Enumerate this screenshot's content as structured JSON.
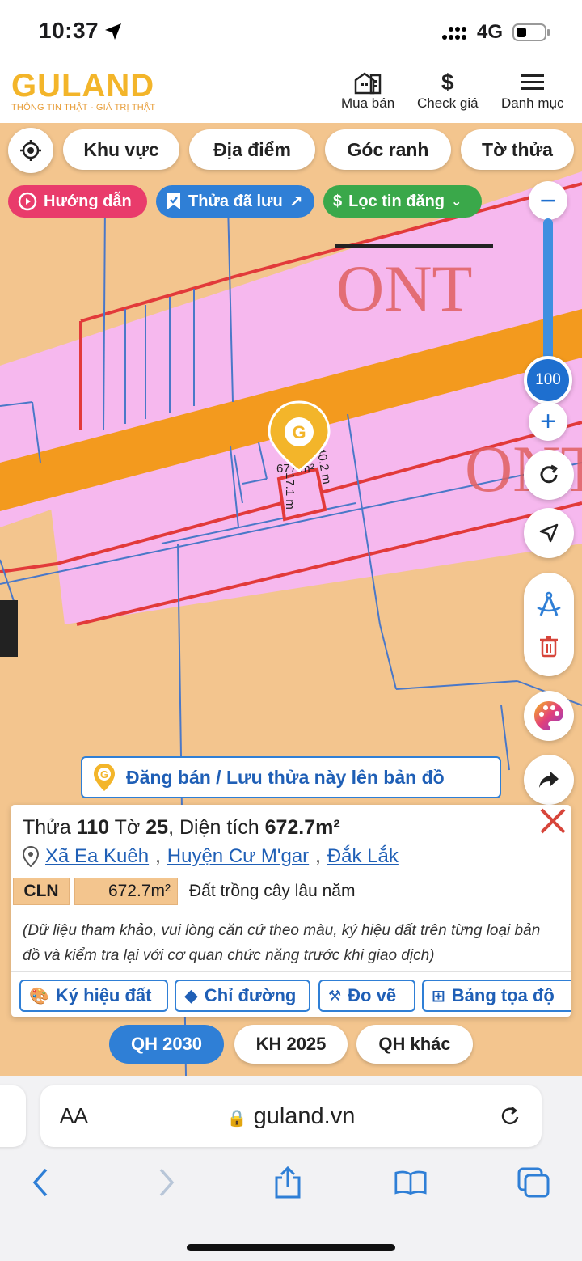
{
  "status": {
    "time": "10:37",
    "network": "4G"
  },
  "brand": {
    "name": "GULAND",
    "tagline": "THÔNG TIN THẬT - GIÁ TRỊ THẬT"
  },
  "header_nav": [
    {
      "label": "Mua bán",
      "icon": "building-icon"
    },
    {
      "label": "Check giá",
      "icon": "dollar-icon"
    },
    {
      "label": "Danh mục",
      "icon": "menu-icon"
    }
  ],
  "filters": {
    "area": "Khu vực",
    "place": "Địa điểm",
    "corner": "Góc ranh",
    "sheet": "Tờ thửa"
  },
  "pills": {
    "guide": "Hướng dẫn",
    "saved": "Thửa đã lưu",
    "filter": "Lọc tin đăng"
  },
  "zoom": {
    "level": "100",
    "fraction": 1.0
  },
  "map_labels": {
    "ont": "ONT",
    "area_label": "677 m²",
    "side_a": "40.2 m",
    "side_b": "17.1 m"
  },
  "post_bar": {
    "label": "Đăng bán / Lưu thửa này lên bản đồ"
  },
  "card": {
    "parcel_word": "Thửa",
    "parcel_no": "110",
    "sheet_word": "Tờ",
    "sheet_no": "25",
    "area_word": ", Diện tích",
    "area_value": "672.7m²",
    "ward": "Xã Ea Kuêh",
    "district": "Huyện Cư M'gar",
    "province": "Đắk Lắk",
    "land_code": "CLN",
    "land_area": "672.7m²",
    "land_desc": "Đất trồng cây lâu năm",
    "note": "(Dữ liệu tham khảo, vui lòng căn cứ theo màu, ký hiệu đất trên từng loại bản đồ và kiểm tra lại với cơ quan chức năng trước khi giao dịch)",
    "actions": [
      "Ký hiệu đất",
      "Chỉ đường",
      "Đo vẽ",
      "Bảng tọa độ"
    ]
  },
  "plans": [
    "QH 2030",
    "KH 2025",
    "QH khác"
  ],
  "browser": {
    "aa": "AA",
    "url": "guland.vn"
  },
  "colors": {
    "brand": "#f3b52a",
    "pink": "#e93b6b",
    "blue": "#2f7fd6",
    "green": "#3aa84a",
    "land": "#f3c58e",
    "residential": "#f6b8ee",
    "road": "#f39a1e"
  }
}
